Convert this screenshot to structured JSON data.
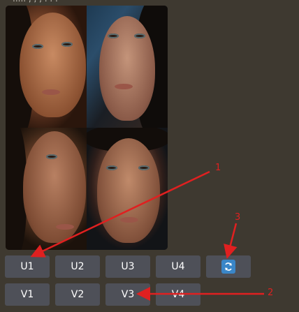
{
  "header": {
    "partial_text": "..... , , , . . ."
  },
  "image_grid": {
    "alt": "four portraits of a woman in the rain"
  },
  "upscale_buttons": [
    "U1",
    "U2",
    "U3",
    "U4"
  ],
  "variation_buttons": [
    "V1",
    "V2",
    "V3",
    "V4"
  ],
  "reroll_button": {
    "icon": "refresh-icon",
    "icon_color": "#3a86c8"
  },
  "annotations": {
    "arrow1_label": "1",
    "arrow2_label": "2",
    "arrow3_label": "3",
    "color": "#e02020"
  },
  "colors": {
    "background": "#3e3930",
    "button": "#4e5058",
    "button_text": "#ffffff"
  }
}
